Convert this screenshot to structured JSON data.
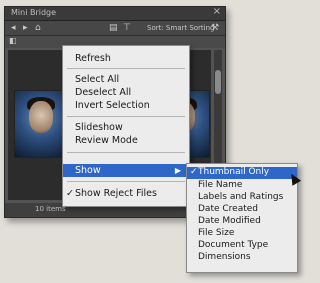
{
  "panel": {
    "title": "Mini Bridge",
    "close_glyph": "×",
    "toolbar": {
      "back": "◂",
      "forward": "▸",
      "home": "⌂",
      "view": "▤",
      "filter": "⊤",
      "sort_label": "Sort: Smart Sorting",
      "tools": "⚒"
    },
    "path_icon": "◧",
    "status_text": "10 items"
  },
  "context_menu": {
    "items": [
      {
        "label": "Refresh"
      },
      {
        "label": "Select All"
      },
      {
        "label": "Deselect All"
      },
      {
        "label": "Invert Selection"
      },
      {
        "label": "Slideshow"
      },
      {
        "label": "Review Mode"
      },
      {
        "label": "Show",
        "arrow": "▶",
        "highlighted": true
      },
      {
        "label": "Show Reject Files",
        "check": "✓"
      }
    ]
  },
  "submenu": {
    "items": [
      {
        "label": "Thumbnail Only",
        "check": "✓",
        "highlighted": true
      },
      {
        "label": "File Name"
      },
      {
        "label": "Labels and Ratings"
      },
      {
        "label": "Date Created"
      },
      {
        "label": "Date Modified"
      },
      {
        "label": "File Size"
      },
      {
        "label": "Document Type"
      },
      {
        "label": "Dimensions"
      }
    ]
  },
  "colors": {
    "highlight": "#2f67c8",
    "panel_bg": "#535353",
    "menu_bg": "#ececec"
  }
}
